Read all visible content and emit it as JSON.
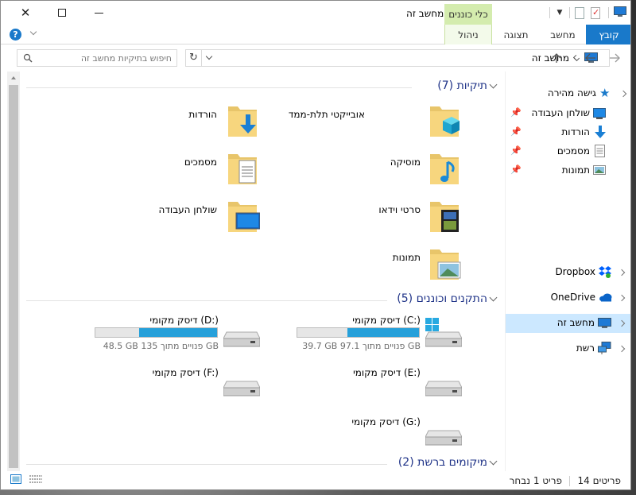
{
  "window": {
    "title": "מחשב זה",
    "context_tab": "כלי כוננים",
    "controls": {
      "close": "✕",
      "maximize": "☐",
      "minimize": "—"
    }
  },
  "ribbon": {
    "tabs": [
      {
        "label": "קובץ",
        "active": true
      },
      {
        "label": "מחשב"
      },
      {
        "label": "תצוגה"
      },
      {
        "label": "ניהול",
        "contextual": true
      }
    ],
    "help": "?"
  },
  "address": {
    "path": "מחשב זה",
    "search_placeholder": "חיפוש בתיקיות מחשב זה"
  },
  "folders_group": {
    "title": "תיקיות (7)",
    "items": [
      {
        "label": "אובייקטי תלת-ממד",
        "icon": "3d-objects-folder-icon"
      },
      {
        "label": "הורדות",
        "icon": "downloads-folder-icon"
      },
      {
        "label": "מוסיקה",
        "icon": "music-folder-icon"
      },
      {
        "label": "מסמכים",
        "icon": "documents-folder-icon"
      },
      {
        "label": "סרטי וידאו",
        "icon": "videos-folder-icon"
      },
      {
        "label": "שולחן העבודה",
        "icon": "desktop-folder-icon"
      },
      {
        "label": "תמונות",
        "icon": "pictures-folder-icon"
      }
    ]
  },
  "devices_group": {
    "title": "התקנים וכוננים (5)",
    "drives": [
      {
        "label": "דיסק מקומי (C:)",
        "free": "39.7 GB פנויים מתוך 97.1 GB",
        "used_fraction": 0.59,
        "system": true
      },
      {
        "label": "דיסק מקומי (D:)",
        "free": "48.5 GB פנויים מתוך 135 GB",
        "used_fraction": 0.64
      },
      {
        "label": "דיסק מקומי (E:)"
      },
      {
        "label": "דיסק מקומי (F:)"
      },
      {
        "label": "דיסק מקומי (G:)"
      }
    ]
  },
  "network_group": {
    "title": "מיקומים ברשת (2)"
  },
  "nav": {
    "quick_access": "גישה מהירה",
    "pinned": [
      "שולחן העבודה",
      "הורדות",
      "מסמכים",
      "תמונות"
    ],
    "dropbox": "Dropbox",
    "onedrive": "OneDrive",
    "this_pc": "מחשב זה",
    "network": "רשת"
  },
  "status": {
    "items_count": "14 פריטים",
    "selected": "פריט 1 נבחר"
  },
  "colors": {
    "accent": "#1979ca",
    "selection": "#cce8ff",
    "drive_bar": "#26a0da",
    "group_title": "#1e3287",
    "context_tab": "#d4ecae"
  }
}
